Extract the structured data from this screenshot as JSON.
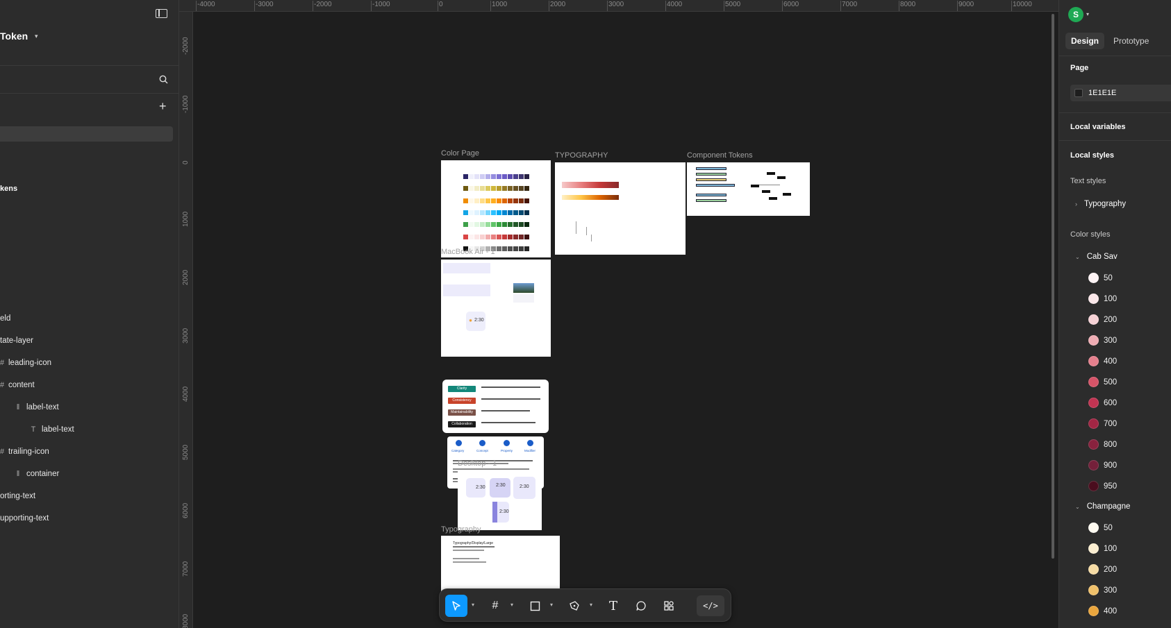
{
  "file_title": "Token",
  "left_panel": {
    "section_label": "kens",
    "layers": [
      {
        "label": "eld",
        "icon": ""
      },
      {
        "label": "tate-layer",
        "icon": ""
      },
      {
        "label": "leading-icon",
        "icon": "frame-icon"
      },
      {
        "label": "content",
        "icon": "frame-icon"
      },
      {
        "label": "label-text",
        "icon": "auto-layout-icon"
      },
      {
        "label": "label-text",
        "icon": "text-icon"
      },
      {
        "label": "trailing-icon",
        "icon": "frame-icon"
      },
      {
        "label": "container",
        "icon": "auto-layout-icon"
      },
      {
        "label": "orting-text",
        "icon": ""
      },
      {
        "label": "upporting-text",
        "icon": ""
      }
    ]
  },
  "rulers": {
    "top": [
      "-4000",
      "-3000",
      "-2000",
      "-1000",
      "0",
      "1000",
      "2000",
      "3000",
      "4000",
      "5000",
      "6000",
      "7000",
      "8000",
      "9000",
      "10000"
    ],
    "left": [
      "-2000",
      "-1000",
      "0",
      "1000",
      "2000",
      "3000",
      "4000",
      "5000",
      "6000",
      "7000",
      "8000"
    ]
  },
  "canvas": {
    "frames": {
      "color_page": "Color Page",
      "typography_top": "TYPOGRAPHY",
      "component_tokens": "Component Tokens",
      "macbook": "MacBook Air - 1",
      "desktop": "Desktop - 1",
      "typography": "Typography"
    },
    "macbook_time": "2:30",
    "desktop_times": [
      "2:30",
      "2:30",
      "2:30",
      "2:30"
    ],
    "principles": [
      "Clarity",
      "Consistency",
      "Maintainability",
      "Collaboration"
    ],
    "principle_colors": [
      "#13877a",
      "#c8432a",
      "#7a5148",
      "#1b1b1b"
    ],
    "steps": [
      "Category",
      "Concept",
      "Property",
      "Modifier"
    ],
    "typography_preview": "Typography/Display/Large"
  },
  "right_panel": {
    "avatar_initial": "S",
    "tabs": {
      "design": "Design",
      "prototype": "Prototype"
    },
    "page_heading": "Page",
    "page_color": "1E1E1E",
    "local_variables": "Local variables",
    "local_styles": "Local styles",
    "text_styles": "Text styles",
    "text_style_group": "Typography",
    "color_styles": "Color styles",
    "groups": [
      {
        "name": "Cab Sav",
        "items": [
          {
            "label": "50",
            "color": "#fdf3f4"
          },
          {
            "label": "100",
            "color": "#fbe7e9"
          },
          {
            "label": "200",
            "color": "#f6d2d6"
          },
          {
            "label": "300",
            "color": "#efadb4"
          },
          {
            "label": "400",
            "color": "#e5808d"
          },
          {
            "label": "500",
            "color": "#d65468"
          },
          {
            "label": "600",
            "color": "#c13452"
          },
          {
            "label": "700",
            "color": "#a22644"
          },
          {
            "label": "800",
            "color": "#88223e"
          },
          {
            "label": "900",
            "color": "#74203a"
          },
          {
            "label": "950",
            "color": "#4a0d1e"
          }
        ]
      },
      {
        "name": "Champagne",
        "items": [
          {
            "label": "50",
            "color": "#fffbf1"
          },
          {
            "label": "100",
            "color": "#fbeed1"
          },
          {
            "label": "200",
            "color": "#f6dca5"
          },
          {
            "label": "300",
            "color": "#f0c16b"
          },
          {
            "label": "400",
            "color": "#eaa63e"
          }
        ]
      }
    ]
  }
}
